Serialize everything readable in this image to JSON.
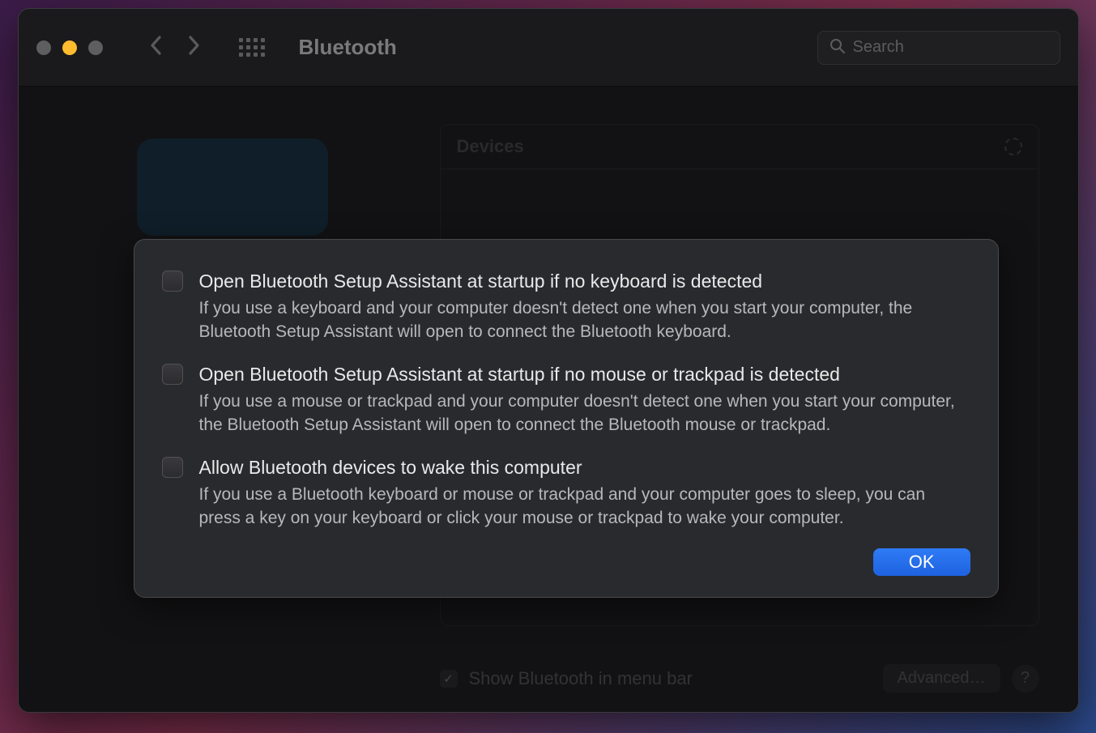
{
  "window": {
    "title": "Bluetooth"
  },
  "search": {
    "placeholder": "Search",
    "value": ""
  },
  "devices": {
    "header": "Devices"
  },
  "footer": {
    "show_in_menu_bar_label": "Show Bluetooth in menu bar",
    "show_in_menu_bar_checked": true,
    "advanced_label": "Advanced…",
    "help_label": "?"
  },
  "modal": {
    "options": [
      {
        "label": "Open Bluetooth Setup Assistant at startup if no keyboard is detected",
        "desc": "If you use a keyboard and your computer doesn't detect one when you start your computer, the Bluetooth Setup Assistant will open to connect the Bluetooth keyboard.",
        "checked": false
      },
      {
        "label": "Open Bluetooth Setup Assistant at startup if no mouse or trackpad is detected",
        "desc": "If you use a mouse or trackpad and your computer doesn't detect one when you start your computer, the Bluetooth Setup Assistant will open to connect the Bluetooth mouse or trackpad.",
        "checked": false
      },
      {
        "label": "Allow Bluetooth devices to wake this computer",
        "desc": "If you use a Bluetooth keyboard or mouse or trackpad and your computer goes to sleep, you can press a key on your keyboard or click your mouse or trackpad to wake your computer.",
        "checked": false
      }
    ],
    "ok_label": "OK"
  }
}
